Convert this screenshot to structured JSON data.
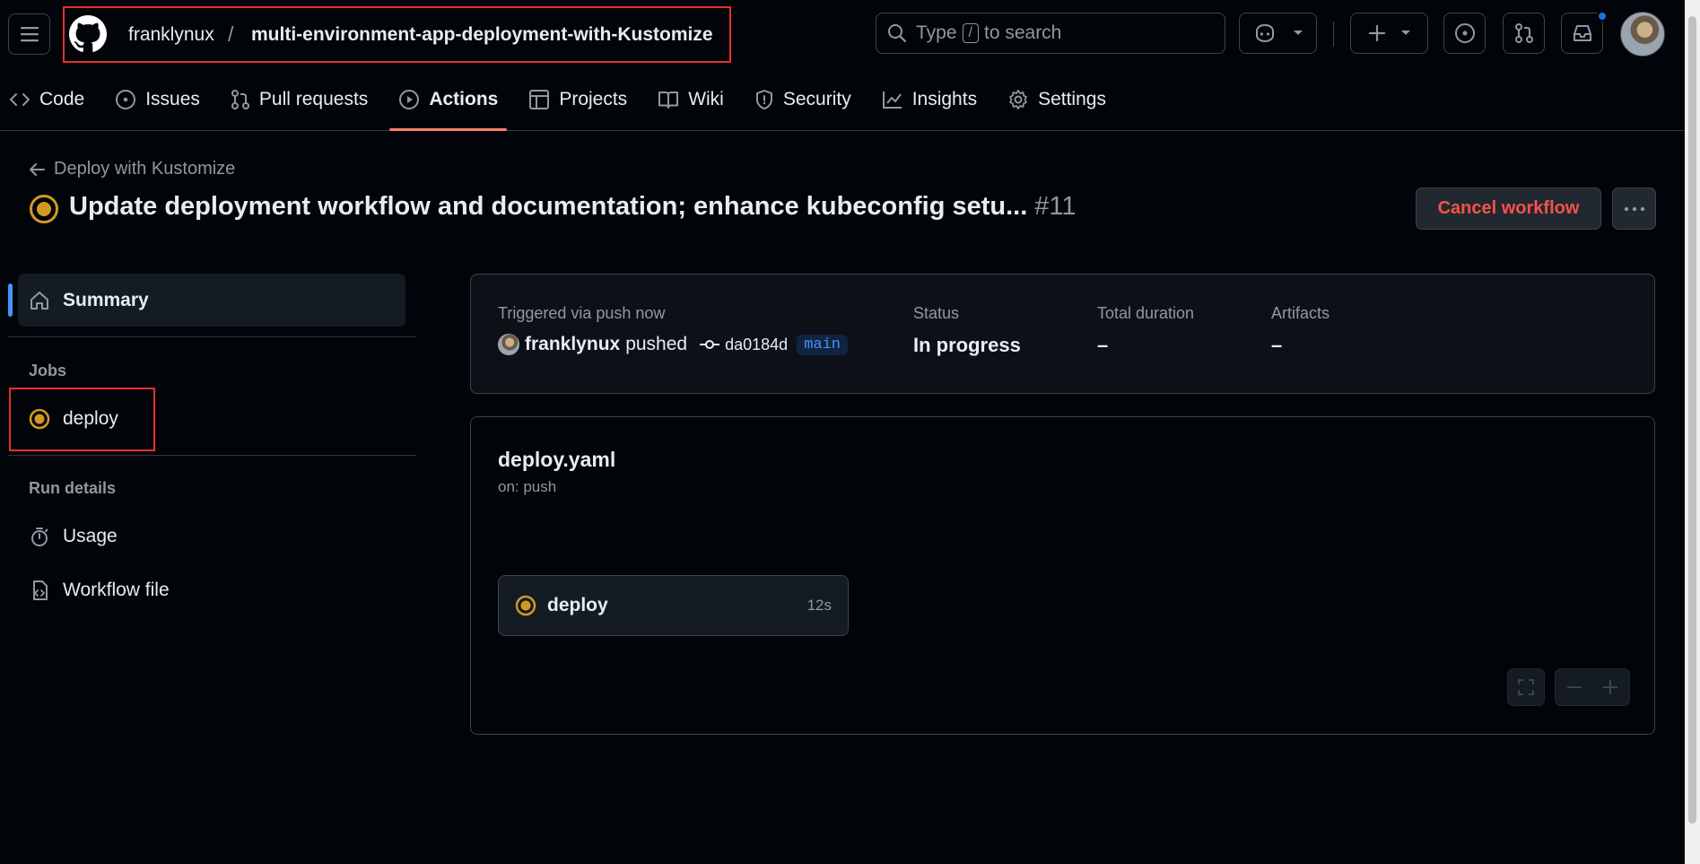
{
  "header": {
    "owner": "franklynux",
    "separator": "/",
    "repo": "multi-environment-app-deployment-with-Kustomize",
    "search": {
      "prefix": "Type",
      "key": "/",
      "suffix": "to search"
    }
  },
  "tabs": [
    {
      "label": "Code",
      "icon": "code-icon"
    },
    {
      "label": "Issues",
      "icon": "issue-icon"
    },
    {
      "label": "Pull requests",
      "icon": "git-pull-request-icon"
    },
    {
      "label": "Actions",
      "icon": "play-icon",
      "active": true
    },
    {
      "label": "Projects",
      "icon": "table-icon"
    },
    {
      "label": "Wiki",
      "icon": "book-icon"
    },
    {
      "label": "Security",
      "icon": "shield-icon"
    },
    {
      "label": "Insights",
      "icon": "graph-icon"
    },
    {
      "label": "Settings",
      "icon": "gear-icon"
    }
  ],
  "run": {
    "back_label": "Deploy with Kustomize",
    "title": "Update deployment workflow and documentation; enhance kubeconfig setu...",
    "number": "#11",
    "cancel_label": "Cancel workflow"
  },
  "sidebar": {
    "summary_label": "Summary",
    "jobs_heading": "Jobs",
    "job_label": "deploy",
    "run_details_heading": "Run details",
    "usage_label": "Usage",
    "workflow_file_label": "Workflow file"
  },
  "summary": {
    "triggered_label": "Triggered via push now",
    "actor": "franklynux",
    "action": "pushed",
    "commit": "da0184d",
    "branch": "main",
    "status_label": "Status",
    "status_value": "In progress",
    "duration_label": "Total duration",
    "duration_value": "–",
    "artifacts_label": "Artifacts",
    "artifacts_value": "–"
  },
  "graph": {
    "workflow_name": "deploy.yaml",
    "trigger": "on: push",
    "job_name": "deploy",
    "job_duration": "12s"
  },
  "colors": {
    "accent_tab": "#f78166",
    "in_progress": "#d29922",
    "danger": "#f85149",
    "link": "#4493f8"
  }
}
